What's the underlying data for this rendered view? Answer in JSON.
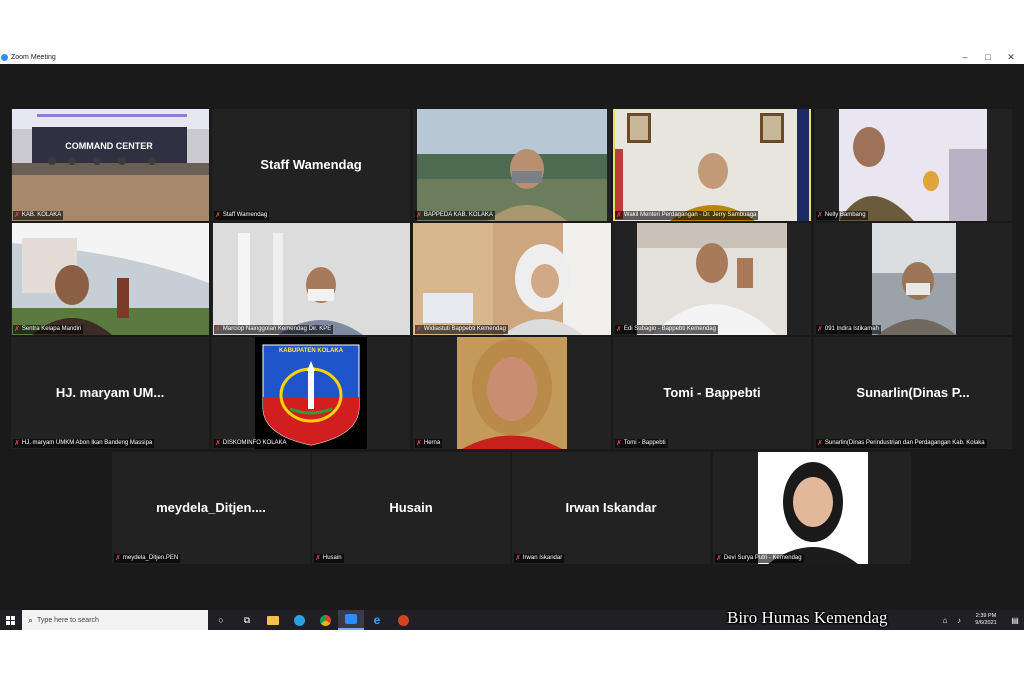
{
  "window": {
    "title": "Zoom Meeting",
    "controls": [
      "–",
      "□",
      "✕"
    ]
  },
  "tiles": [
    {
      "big_name": "",
      "label": "KAB. KOLAKA",
      "video": "command-center"
    },
    {
      "big_name": "Staff Wamendag",
      "label": "Staff Wamendag",
      "video": ""
    },
    {
      "big_name": "",
      "label": "BAPPEDA KAB. KOLAKA",
      "video": "person-landscape"
    },
    {
      "big_name": "",
      "label": "Wakil Menteri Perdagangan - Dr. Jerry Sambuaga",
      "video": "person-office"
    },
    {
      "big_name": "",
      "label": "Nelly Bambang",
      "video": "person-room"
    },
    {
      "big_name": "",
      "label": "Sentra Kelapa Mandiri",
      "video": "person-outdoor"
    },
    {
      "big_name": "",
      "label": "Marciop Nainggolan Kemendag Dir. KPE",
      "video": "person-white"
    },
    {
      "big_name": "",
      "label": "Widiastuti Bappebti Kemendag",
      "video": "person-hijab"
    },
    {
      "big_name": "",
      "label": "Edi Subagio - Bappebti Kemendag",
      "video": "person-glasses"
    },
    {
      "big_name": "",
      "label": "091 Indira Istikamah",
      "video": "person-mask"
    },
    {
      "big_name": "HJ. maryam UM...",
      "label": "HJ. maryam UMKM Abon Ikan Bandeng Massipa",
      "video": ""
    },
    {
      "big_name": "",
      "label": "DISKOMINFO KOLAKA",
      "video": "emblem",
      "emblem_text": "KABUPATEN KOLAKA"
    },
    {
      "big_name": "",
      "label": "Herna",
      "video": "person-close"
    },
    {
      "big_name": "Tomi - Bappebti",
      "label": "Tomi - Bappebti",
      "video": ""
    },
    {
      "big_name": "Sunarlin(Dinas P...",
      "label": "Sunarlin(Dinas Perindustrian dan Perdagangan Kab. Kolaka",
      "video": ""
    },
    {
      "big_name": "meydela_Ditjen....",
      "label": "meydela_Ditjen.PEN",
      "video": ""
    },
    {
      "big_name": "Husain",
      "label": "Husain",
      "video": ""
    },
    {
      "big_name": "Irwan Iskandar",
      "label": "Irwan Iskandar",
      "video": ""
    },
    {
      "big_name": "",
      "label": "Devi Surya Putri - Kemendag",
      "video": "person-portrait"
    }
  ],
  "taskbar": {
    "search_placeholder": "Type here to search",
    "time": "2:39 PM",
    "date": "9/6/2021"
  },
  "watermark": "Biro Humas Kemendag",
  "colors": {
    "mic_muted": "#e34646",
    "active_speaker": "#e8e05a",
    "zoom_blue": "#2d8cff"
  }
}
